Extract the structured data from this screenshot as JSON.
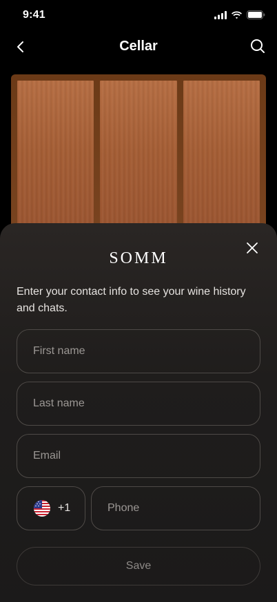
{
  "status_bar": {
    "time": "9:41"
  },
  "nav": {
    "title": "Cellar",
    "back_icon": "chevron-left-icon",
    "search_icon": "search-icon"
  },
  "sheet": {
    "logo": "SOMM",
    "intro": "Enter your contact info to see your wine history and chats.",
    "fields": {
      "first_name_placeholder": "First name",
      "last_name_placeholder": "Last name",
      "email_placeholder": "Email",
      "phone_placeholder": "Phone"
    },
    "country_code": "+1",
    "save_label": "Save"
  }
}
